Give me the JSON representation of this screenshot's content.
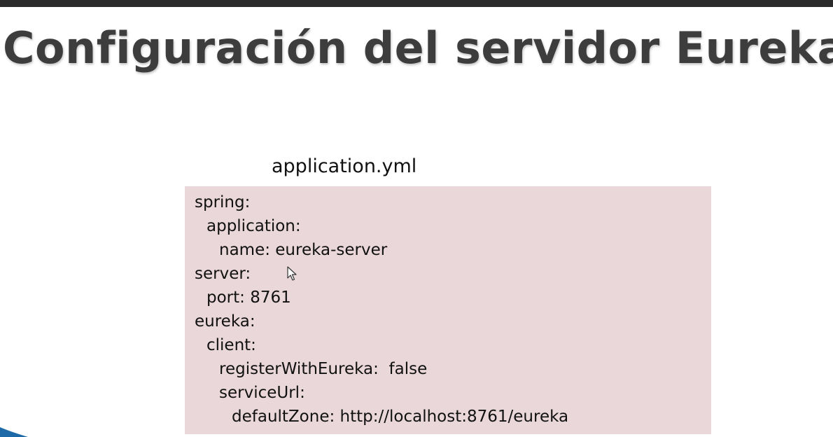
{
  "slide": {
    "title": "Configuración del servidor Eureka",
    "file_label": "application.yml",
    "code_lines": [
      "spring:",
      "application:",
      "name: eureka-server",
      "server:",
      "port: 8761",
      "eureka:",
      "client:",
      "registerWithEureka:  false",
      "serviceUrl:",
      "defaultZone: http://localhost:8761/eureka"
    ]
  },
  "colors": {
    "code_background": "#ead7da",
    "title_text": "#3d3d3d",
    "top_bar": "#2b2b2b",
    "corner_accent": "#1e6aa8"
  },
  "icons": {
    "cursor": "mouse-pointer-icon"
  }
}
